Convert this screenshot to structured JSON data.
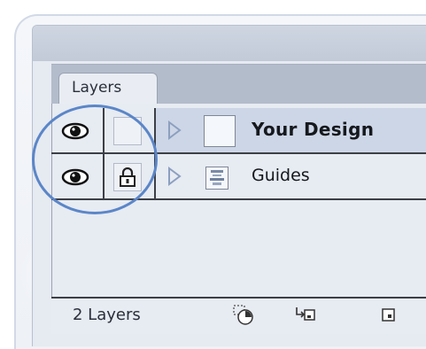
{
  "panel": {
    "tab_label": "Layers",
    "layers": [
      {
        "name": "Your Design",
        "visible": true,
        "locked": false,
        "selected": true,
        "thumb_icon": "blank-thumbnail-icon"
      },
      {
        "name": "Guides",
        "visible": true,
        "locked": true,
        "selected": false,
        "thumb_icon": "guides-thumbnail-icon"
      }
    ],
    "footer": {
      "layer_count": "2 Layers",
      "icons": [
        "locate-object-icon",
        "make-clipping-mask-icon",
        "new-sublayer-icon",
        "new-layer-icon"
      ]
    }
  },
  "colors": {
    "highlight_circle": "#5b86c8",
    "selected_row": "#cdd6e6",
    "panel_bg": "#e7ebf2"
  }
}
